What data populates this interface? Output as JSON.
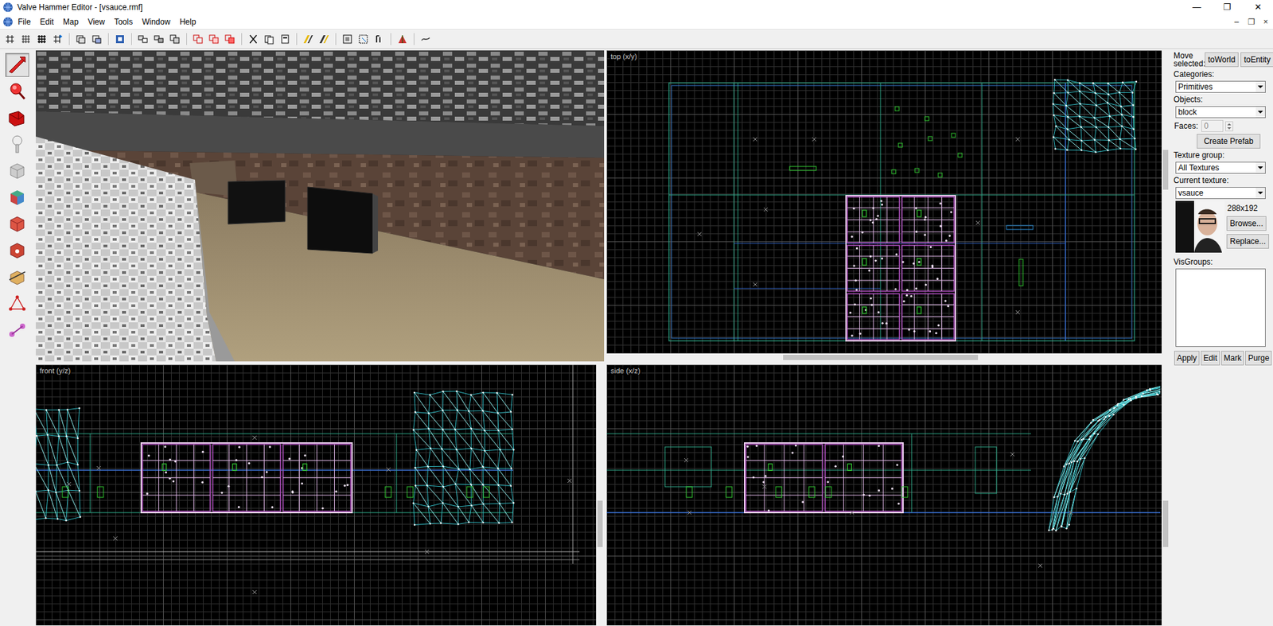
{
  "window": {
    "title": "Valve Hammer Editor - [vsauce.rmf]",
    "controls": [
      "—",
      "❐",
      "✕"
    ]
  },
  "menu": {
    "items": [
      "File",
      "Edit",
      "Map",
      "View",
      "Tools",
      "Window",
      "Help"
    ],
    "doc_controls": [
      "–",
      "❐",
      "×"
    ]
  },
  "tools": [
    {
      "kind": "selection",
      "selected": true
    },
    {
      "kind": "magnify",
      "selected": false
    },
    {
      "kind": "camera",
      "selected": false
    },
    {
      "kind": "entity",
      "selected": false
    },
    {
      "kind": "block",
      "selected": false
    },
    {
      "kind": "texture",
      "selected": false
    },
    {
      "kind": "apply-texture",
      "selected": false
    },
    {
      "kind": "decal",
      "selected": false
    },
    {
      "kind": "clip",
      "selected": false
    },
    {
      "kind": "vertex",
      "selected": false
    },
    {
      "kind": "path",
      "selected": false
    }
  ],
  "viewports": [
    {
      "label": "top (x/y)"
    },
    {
      "label": "front (y/z)"
    },
    {
      "label": "side (x/z)"
    }
  ],
  "panel": {
    "move_label": "Move selected:",
    "move_buttons": [
      "toWorld",
      "toEntity"
    ],
    "categories": {
      "label": "Categories:",
      "value": "Primitives"
    },
    "objects": {
      "label": "Objects:",
      "value": "block"
    },
    "faces": {
      "label": "Faces:",
      "value": "0",
      "disabled": true
    },
    "create_prefab": "Create Prefab",
    "texture_group": {
      "label": "Texture group:",
      "value": "All Textures"
    },
    "current_texture": {
      "label": "Current texture:",
      "value": "vsauce"
    },
    "texture_size": "288x192",
    "texture_buttons": [
      "Browse...",
      "Replace..."
    ],
    "visgroups": {
      "label": "VisGroups:"
    },
    "visgroup_buttons": [
      "Apply",
      "Edit",
      "Mark",
      "Purge"
    ]
  }
}
